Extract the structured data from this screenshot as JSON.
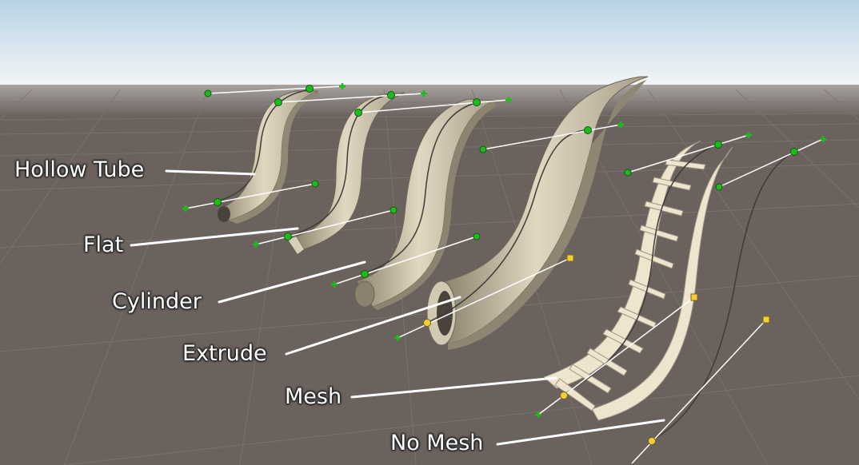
{
  "labels": {
    "hollow_tube": "Hollow Tube",
    "flat": "Flat",
    "cylinder": "Cylinder",
    "extrude": "Extrude",
    "mesh": "Mesh",
    "no_mesh": "No Mesh"
  },
  "colors": {
    "sky_top": "#c3d9ea",
    "sky_horizon": "#f4f6f7",
    "ground": "#6b625e",
    "grid_line": "#7d7470",
    "mesh_light": "#e6dcc7",
    "mesh_shade": "#9f9682",
    "ladder": "#efe5cf",
    "handle_line": "#ffffff",
    "handle_green": "#1dbb1d",
    "handle_yellow": "#f0cf3a",
    "callout_text": "#ffffff"
  },
  "icons": {
    "knot": "green-circle",
    "tangent_end": "green-plus",
    "selected_knot": "yellow-square"
  }
}
